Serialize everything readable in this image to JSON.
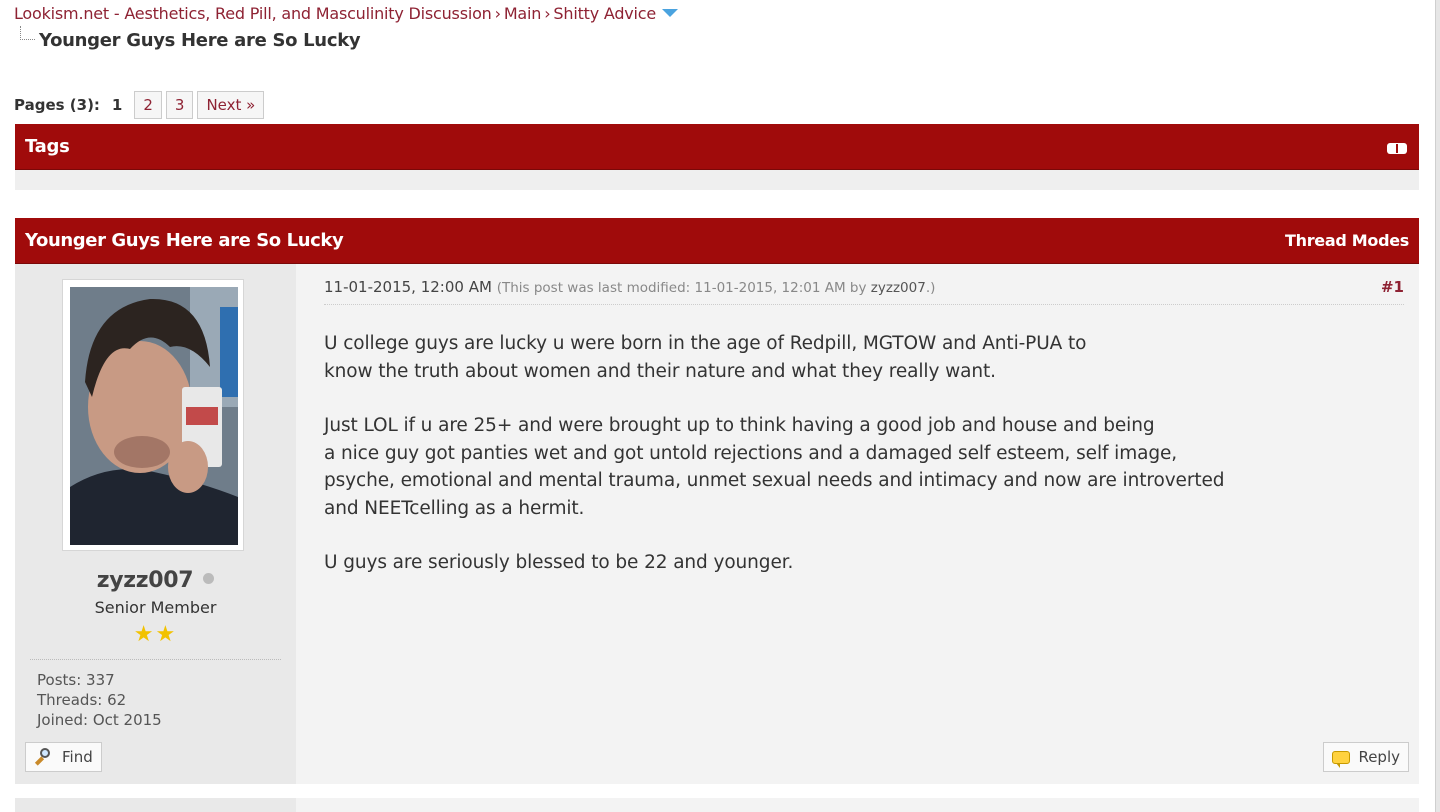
{
  "breadcrumb": {
    "items": [
      "Lookism.net - Aesthetics, Red Pill, and Masculinity Discussion",
      "Main",
      "Shitty Advice"
    ],
    "separator": "›",
    "current": "Younger Guys Here are So Lucky"
  },
  "pagination": {
    "label": "Pages (3):",
    "current": "1",
    "pages": [
      "2",
      "3"
    ],
    "next": "Next »"
  },
  "tags": {
    "title": "Tags"
  },
  "thread": {
    "title": "Younger Guys Here are So Lucky",
    "modes_label": "Thread Modes"
  },
  "post": {
    "author": {
      "username": "zyzz007",
      "status": "offline",
      "title": "Senior Member",
      "stars": "★★",
      "stats": [
        "Posts: 337",
        "Threads: 62",
        "Joined: Oct 2015"
      ]
    },
    "date": "11-01-2015, 12:00 AM",
    "modified_prefix": "(This post was last modified: 11-01-2015, 12:01 AM by",
    "modified_by": "zyzz007",
    "modified_suffix": ".)",
    "number": "#1",
    "paragraphs": [
      [
        "U college guys are lucky u were born in the age of Redpill, MGTOW and Anti-PUA to",
        "know the truth about women and their nature and what they really want."
      ],
      [
        "Just LOL if u are 25+ and were brought up to think having a good job and house and being",
        "a nice guy got panties wet and got untold rejections and a damaged self esteem, self image,",
        "psyche, emotional and mental trauma, unmet sexual needs and intimacy and now are introverted",
        "and NEETcelling as a hermit."
      ],
      [
        "U guys are seriously blessed to be 22 and younger."
      ]
    ],
    "find_label": "Find",
    "reply_label": "Reply"
  },
  "colors": {
    "header_bg": "#a00b0b",
    "link": "#8e2233",
    "accent_dropdown": "#4aa3df"
  },
  "icons": [
    "dropdown-arrow-icon",
    "collapse-icon",
    "offline-status-icon",
    "star-icon",
    "magnifier-icon",
    "speech-bubble-icon"
  ]
}
